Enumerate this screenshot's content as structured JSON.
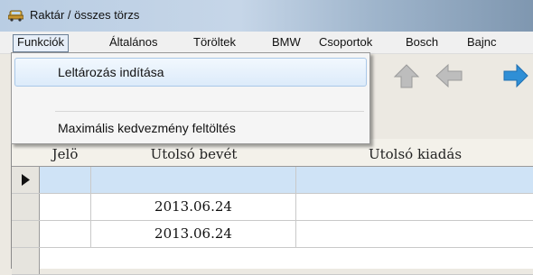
{
  "window": {
    "title": "Raktár / összes törzs",
    "icon": "car-icon"
  },
  "menubar": {
    "items": [
      "Funkciók",
      "Általános",
      "Töröltek",
      "BMW",
      "Csoportok",
      "Bosch",
      "Bajnc"
    ]
  },
  "dropdown": {
    "items": [
      "Leltározás indítása",
      "Maximális kedvezmény feltöltés"
    ]
  },
  "toolbar": {
    "buttons": [
      "arrow-up-icon",
      "arrow-left-icon",
      "arrow-right-icon"
    ]
  },
  "grid": {
    "columns": [
      "Jelö",
      "Utolsó bevét",
      "Utolsó kiadás"
    ],
    "rows": [
      {
        "current": true,
        "jelo": "",
        "utolso_bevet": "",
        "utolso_kiadas": ""
      },
      {
        "current": false,
        "jelo": "",
        "utolso_bevet": "2013.06.24",
        "utolso_kiadas": ""
      },
      {
        "current": false,
        "jelo": "",
        "utolso_bevet": "2013.06.24",
        "utolso_kiadas": ""
      }
    ]
  },
  "colors": {
    "selection": "#cfe3f6",
    "toolbar_arrow": "#b7b7b7",
    "toolbar_arrow_active": "#2f8fd6"
  }
}
